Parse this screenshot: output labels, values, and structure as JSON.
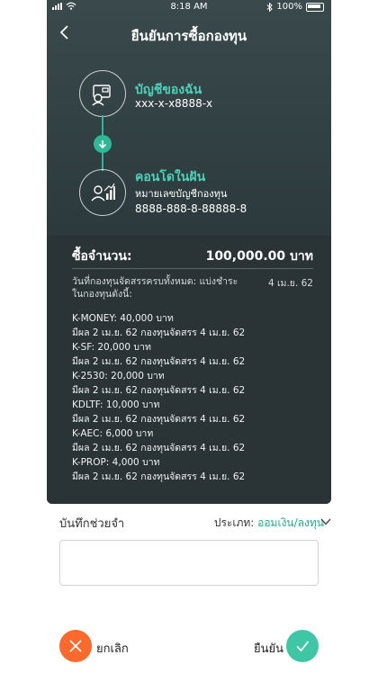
{
  "status_bar": {
    "time": "8:18 AM",
    "battery": "100%"
  },
  "header": {
    "title": "ยืนยันการซื้อกองทุน"
  },
  "source_account": {
    "label": "บัญชีของฉัน",
    "number": "xxx-x-x8888-x"
  },
  "target_fund": {
    "label": "คอนโดในฝัน",
    "sub_label": "หมายเลขบัญชีกองทุน",
    "number": "8888-888-8-88888-8"
  },
  "summary": {
    "label": "ซื้อจำนวน:",
    "amount": "100,000.00 บาท",
    "allocation_title": "วันที่กองทุนจัดสรรครบทั้งหมด: แบ่งชำระในกองทุนดังนี้:",
    "allocation_date": "4 เม.ย. 62",
    "items": [
      {
        "fund": "K-MONEY: 40,000 บาท",
        "note": "มีผล 2 เม.ย. 62 กองทุนจัดสรร 4 เม.ย. 62"
      },
      {
        "fund": "K-SF: 20,000 บาท",
        "note": "มีผล 2 เม.ย. 62 กองทุนจัดสรร 4 เม.ย. 62"
      },
      {
        "fund": "K-2530: 20,000 บาท",
        "note": "มีผล 2 เม.ย. 62 กองทุนจัดสรร 4 เม.ย. 62"
      },
      {
        "fund": "KDLTF: 10,000 บาท",
        "note": "มีผล 2 เม.ย. 62 กองทุนจัดสรร 4 เม.ย. 62"
      },
      {
        "fund": "K-AEC: 6,000 บาท",
        "note": "มีผล 2 เม.ย. 62 กองทุนจัดสรร 4 เม.ย. 62"
      },
      {
        "fund": "K-PROP: 4,000 บาท",
        "note": "มีผล 2 เม.ย. 62 กองทุนจัดสรร 4 เม.ย. 62"
      }
    ]
  },
  "memo": {
    "label": "บันทึกช่วยจำ",
    "type_label": "ประเภท:",
    "type_value": "ออมเงิน/ลงทุน",
    "value": "",
    "placeholder": ""
  },
  "actions": {
    "cancel_label": "ยกเลิก",
    "confirm_label": "ยืนยัน"
  },
  "colors": {
    "accent": "#26a98f",
    "cancel": "#ff6a2c",
    "confirm": "#3fc7a5",
    "panel": "#2c3a3d"
  },
  "icons": [
    "wifi-icon",
    "bluetooth-icon",
    "battery-icon",
    "back-chevron-icon",
    "bank-account-icon",
    "down-arrow-icon",
    "investor-growth-icon",
    "chevron-down-icon",
    "close-icon",
    "check-icon"
  ]
}
